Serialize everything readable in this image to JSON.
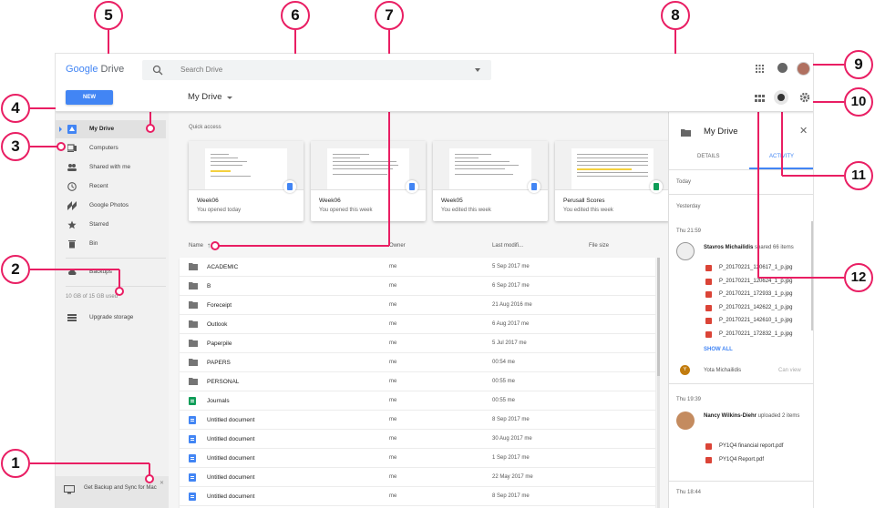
{
  "header": {
    "logo_google": "Google",
    "logo_drive": "Drive",
    "search_placeholder": "Search Drive"
  },
  "toolbar": {
    "new_label": "NEW",
    "breadcrumb": "My Drive"
  },
  "sidebar": {
    "items": [
      {
        "label": "My Drive",
        "icon": "drive-icon",
        "active": true
      },
      {
        "label": "Computers",
        "icon": "computer-icon"
      },
      {
        "label": "Shared with me",
        "icon": "people-icon"
      },
      {
        "label": "Recent",
        "icon": "clock-icon"
      },
      {
        "label": "Google Photos",
        "icon": "photos-icon"
      },
      {
        "label": "Starred",
        "icon": "star-icon"
      },
      {
        "label": "Bin",
        "icon": "trash-icon"
      }
    ],
    "backups": "Backups",
    "storage": "10 GB of 15 GB used",
    "upgrade": "Upgrade storage",
    "backup_promo": "Get Backup and Sync for Mac"
  },
  "quick_access": {
    "title": "Quick access",
    "cards": [
      {
        "name": "Week06",
        "sub": "You opened today",
        "type": "doc"
      },
      {
        "name": "Week06",
        "sub": "You opened this week",
        "type": "doc"
      },
      {
        "name": "Week05",
        "sub": "You edited this week",
        "type": "doc"
      },
      {
        "name": "Perusall Scores",
        "sub": "You edited this week",
        "type": "sheet"
      }
    ]
  },
  "file_list": {
    "columns": {
      "name": "Name",
      "owner": "Owner",
      "modified": "Last modifi...",
      "size": "File size"
    },
    "rows": [
      {
        "name": "ACADEMIC",
        "owner": "me",
        "modified": "5 Sep 2017 me",
        "type": "folder"
      },
      {
        "name": "B",
        "owner": "me",
        "modified": "6 Sep 2017 me",
        "type": "folder"
      },
      {
        "name": "Foreceipt",
        "owner": "me",
        "modified": "21 Aug 2016 me",
        "type": "folder"
      },
      {
        "name": "Outlook",
        "owner": "me",
        "modified": "6 Aug 2017 me",
        "type": "folder"
      },
      {
        "name": "Paperpile",
        "owner": "me",
        "modified": "5 Jul 2017 me",
        "type": "folder"
      },
      {
        "name": "PAPERS",
        "owner": "me",
        "modified": "00:54 me",
        "type": "folder"
      },
      {
        "name": "PERSONAL",
        "owner": "me",
        "modified": "00:55 me",
        "type": "folder"
      },
      {
        "name": "Journals",
        "owner": "me",
        "modified": "00:55 me",
        "type": "sheet"
      },
      {
        "name": "Untitled document",
        "owner": "me",
        "modified": "8 Sep 2017 me",
        "type": "doc"
      },
      {
        "name": "Untitled document",
        "owner": "me",
        "modified": "30 Aug 2017 me",
        "type": "doc"
      },
      {
        "name": "Untitled document",
        "owner": "me",
        "modified": "1 Sep 2017 me",
        "type": "doc"
      },
      {
        "name": "Untitled document",
        "owner": "me",
        "modified": "22 May 2017 me",
        "type": "doc"
      },
      {
        "name": "Untitled document",
        "owner": "me",
        "modified": "8 Sep 2017 me",
        "type": "doc"
      }
    ]
  },
  "details_panel": {
    "title": "My Drive",
    "tab_details": "DETAILS",
    "tab_activity": "ACTIVITY",
    "today": "Today",
    "yesterday": "Yesterday",
    "time1": "Thu 21:59",
    "actor1": "Stavros Michailidis",
    "action1": " shared 66 items",
    "files1": [
      "P_20170221_120617_1_p.jpg",
      "P_20170221_120624_1_p.jpg",
      "P_20170221_172933_1_p.jpg",
      "P_20170221_142622_1_p.jpg",
      "P_20170221_142610_1_p.jpg",
      "P_20170221_172832_1_p.jpg"
    ],
    "show_all": "SHOW ALL",
    "user_initial": "Y",
    "user_name": "Yota Michailidis",
    "user_perm": "Can view",
    "time2": "Thu 19:39",
    "actor2": "Nancy Wilkins-Diehr",
    "action2": " uploaded 2 items",
    "files2": [
      "PY1Q4 financial report.pdf",
      "PY1Q4 Report.pdf"
    ],
    "time3": "Thu 18:44"
  },
  "callouts": [
    "1",
    "2",
    "3",
    "4",
    "5",
    "6",
    "7",
    "8",
    "9",
    "10",
    "11",
    "12"
  ],
  "colors": {
    "accent": "#4285f4",
    "callout": "#e91e63",
    "sheet": "#0f9d58",
    "image": "#db4437"
  }
}
